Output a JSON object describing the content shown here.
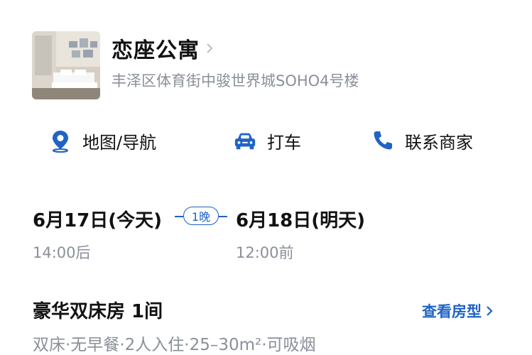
{
  "hotel": {
    "name": "恋座公寓",
    "address": "丰泽区体育街中骏世界城SOHO4号楼"
  },
  "actions": [
    {
      "label": "地图/导航",
      "icon": "location-pin-icon"
    },
    {
      "label": "打车",
      "icon": "car-icon"
    },
    {
      "label": "联系商家",
      "icon": "phone-icon"
    }
  ],
  "stay": {
    "checkin_date": "6月17日(今天)",
    "checkin_time": "14:00后",
    "nights": "1晚",
    "checkout_date": "6月18日(明天)",
    "checkout_time": "12:00前"
  },
  "room": {
    "title": "豪华双床房 1间",
    "view_label": "查看房型",
    "description": "双床·无早餐·2人入住·25–30m²·可吸烟"
  },
  "colors": {
    "accent": "#1f63c6",
    "secondary_text": "#8a8f99"
  }
}
